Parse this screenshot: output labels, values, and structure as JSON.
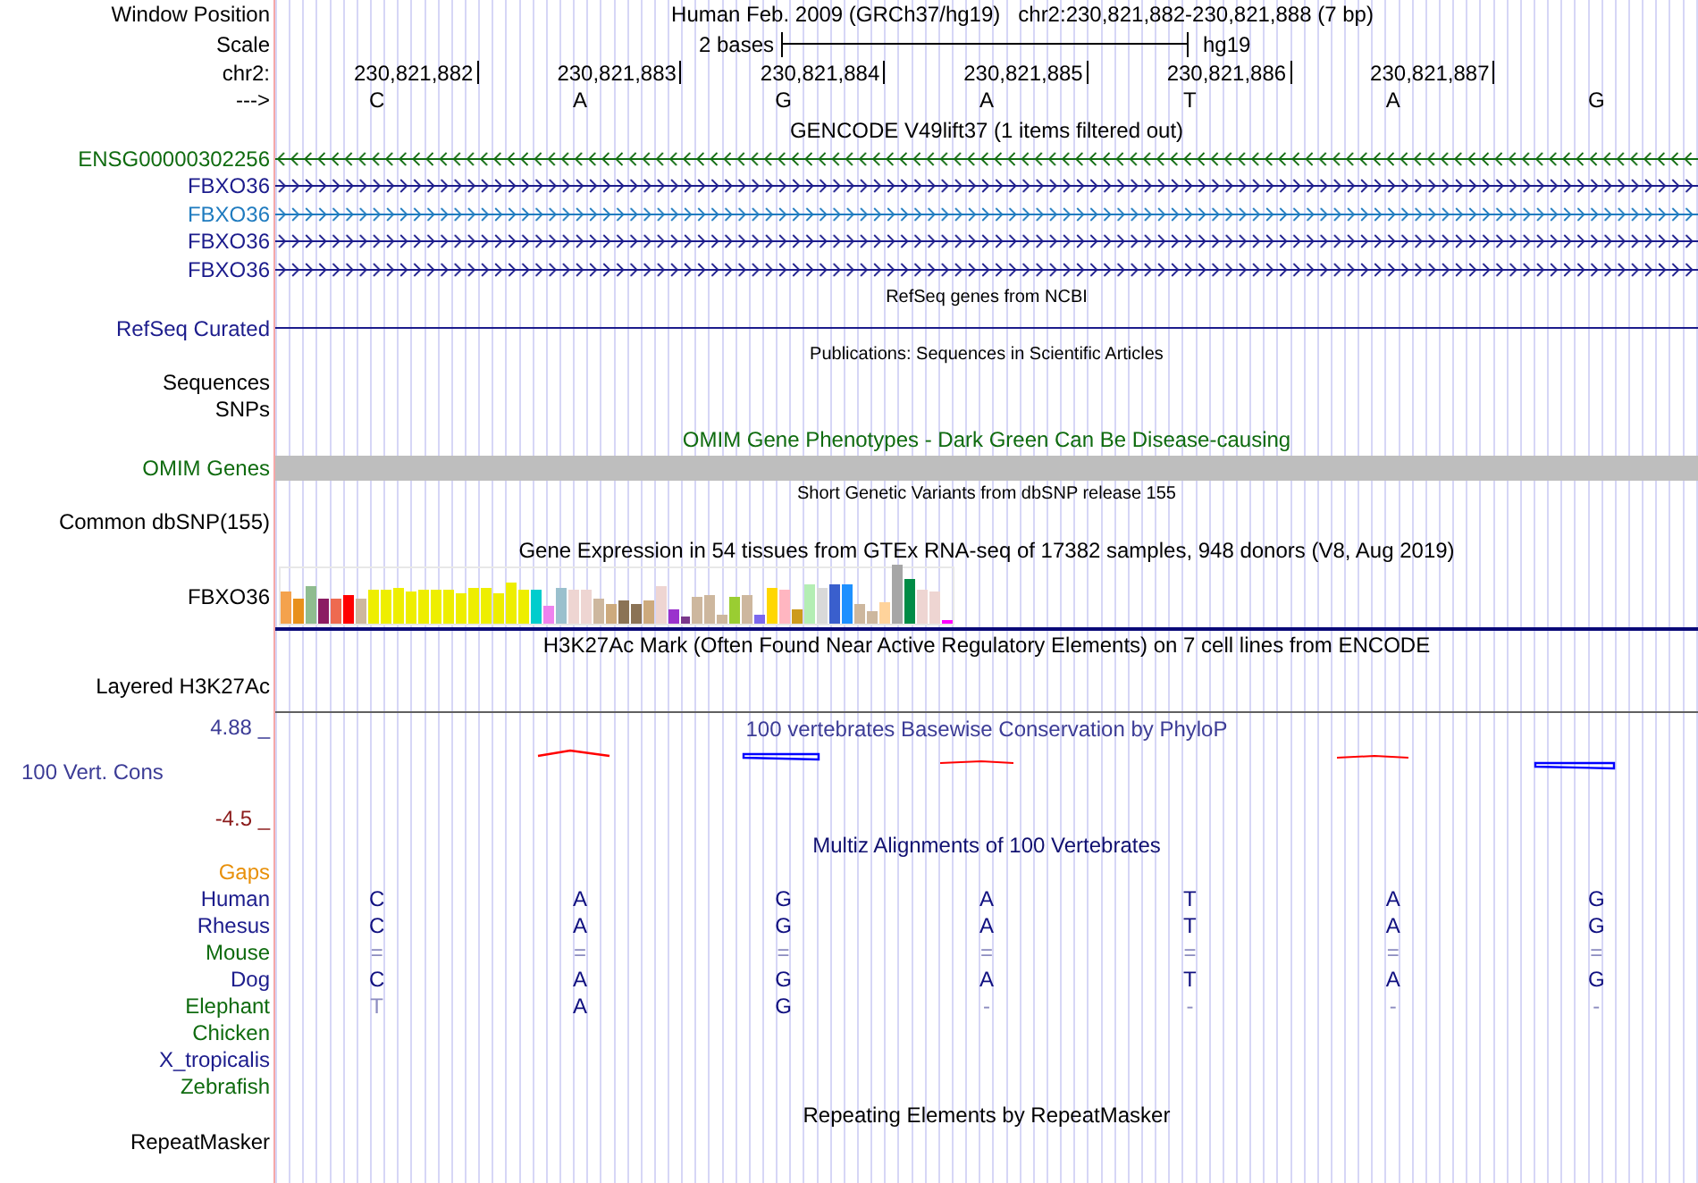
{
  "header": {
    "window_label": "Window Position",
    "assembly_title": "Human Feb. 2009 (GRCh37/hg19)",
    "position_title": "chr2:230,821,882-230,821,888 (7 bp)",
    "scale_label": "Scale",
    "scale_text": "2 bases",
    "scale_db": "hg19",
    "chrom_label": "chr2:",
    "strand_label": "--->"
  },
  "positions": [
    "230,821,882",
    "230,821,883",
    "230,821,884",
    "230,821,885",
    "230,821,886",
    "230,821,887"
  ],
  "bases": [
    "C",
    "A",
    "G",
    "A",
    "T",
    "A",
    "G"
  ],
  "tracks": [
    {
      "kind": "genes",
      "title": "GENCODE V49lift37 (1 items filtered out)",
      "items": [
        {
          "name": "ENSG00000302256",
          "color": "#0f6b0f",
          "reverse_strand": true
        },
        {
          "name": "FBXO36",
          "color": "#1c1c8c",
          "reverse_strand": false
        },
        {
          "name": "FBXO36",
          "color": "#1f7bbf",
          "reverse_strand": false
        },
        {
          "name": "FBXO36",
          "color": "#1c1c8c",
          "reverse_strand": false
        },
        {
          "name": "FBXO36",
          "color": "#1c1c8c",
          "reverse_strand": false
        }
      ]
    },
    {
      "kind": "line",
      "title": "RefSeq genes from NCBI",
      "label": "RefSeq Curated",
      "color": "#1c1c8c"
    },
    {
      "kind": "labels",
      "title": "Publications: Sequences in Scientific Articles",
      "labels": [
        "Sequences",
        "SNPs"
      ]
    },
    {
      "kind": "bar",
      "title": "OMIM Gene Phenotypes - Dark Green Can Be Disease-causing",
      "label": "OMIM Genes",
      "color": "#0f6b0f"
    },
    {
      "kind": "labels",
      "title": "Short Genetic Variants from dbSNP release 155",
      "labels": [
        "Common dbSNP(155)"
      ]
    },
    {
      "kind": "expression",
      "title": "Gene Expression in 54 tissues from GTEx RNA-seq of 17382 samples, 948 donors (V8, Aug 2019)",
      "label": "FBXO36"
    },
    {
      "kind": "rule",
      "title": "H3K27Ac Mark (Often Found Near Active Regulatory Elements) on 7 cell lines from ENCODE",
      "label": "Layered H3K27Ac"
    },
    {
      "kind": "wiggle",
      "title": "100 vertebrates Basewise Conservation by PhyloP",
      "label": "100 Vert. Cons",
      "max": "4.88 _",
      "min": "-4.5 _",
      "color": "#3c3c96"
    },
    {
      "kind": "alignment",
      "title": "Multiz Alignments of 100 Vertebrates",
      "color": "#101070",
      "gaps": {
        "label": "Gaps",
        "color": "#e8900a"
      },
      "rows": [
        {
          "species": "Human",
          "color": "#1c1c8c",
          "bases": [
            "C",
            "A",
            "G",
            "A",
            "T",
            "A",
            "G"
          ]
        },
        {
          "species": "Rhesus",
          "color": "#1c1c8c",
          "bases": [
            "C",
            "A",
            "G",
            "A",
            "T",
            "A",
            "G"
          ]
        },
        {
          "species": "Mouse",
          "color": "#0f6b0f",
          "bases": [
            "=",
            "=",
            "=",
            "=",
            "=",
            "=",
            "="
          ],
          "faint": [
            true,
            true,
            true,
            true,
            true,
            true,
            true
          ]
        },
        {
          "species": "Dog",
          "color": "#1c1c8c",
          "bases": [
            "C",
            "A",
            "G",
            "A",
            "T",
            "A",
            "G"
          ]
        },
        {
          "species": "Elephant",
          "color": "#0f6b0f",
          "bases": [
            "T",
            "A",
            "G",
            "-",
            "-",
            "-",
            "-"
          ],
          "faint": [
            true,
            false,
            false,
            true,
            true,
            true,
            true
          ]
        },
        {
          "species": "Chicken",
          "color": "#0f6b0f",
          "bases": []
        },
        {
          "species": "X_tropicalis",
          "color": "#1c1c8c",
          "bases": []
        },
        {
          "species": "Zebrafish",
          "color": "#0f6b0f",
          "bases": []
        }
      ]
    },
    {
      "kind": "repeats",
      "title": "Repeating Elements by RepeatMasker",
      "label": "RepeatMasker"
    }
  ]
}
